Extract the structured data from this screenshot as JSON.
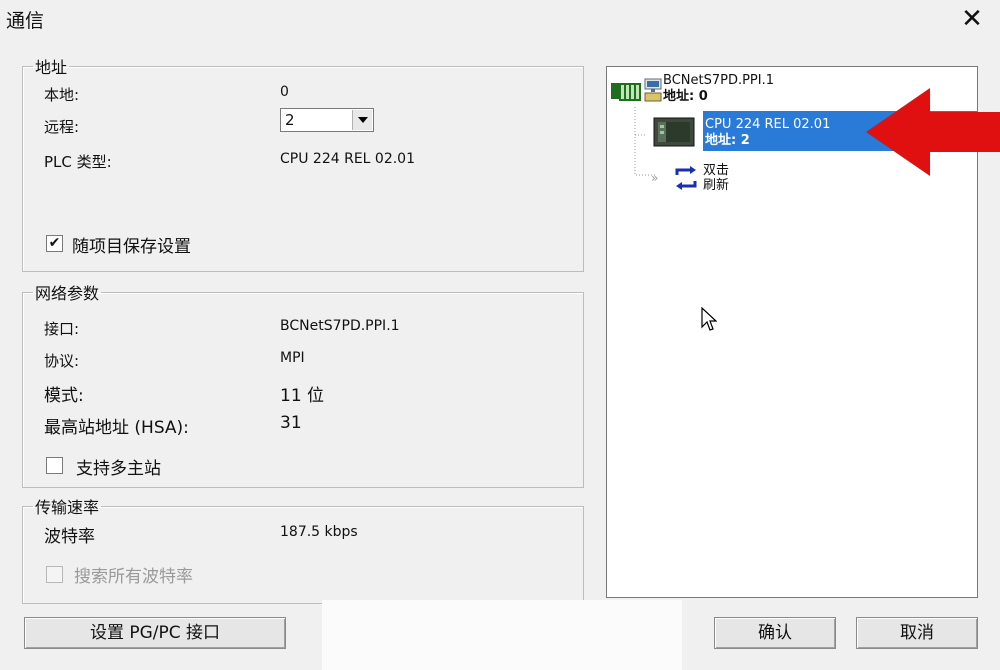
{
  "window": {
    "title": "通信",
    "close_glyph": "✕"
  },
  "address": {
    "legend": "地址",
    "local_label": "本地:",
    "local_value": "0",
    "remote_label": "远程:",
    "remote_value": "2",
    "plc_type_label": "PLC 类型:",
    "plc_type_value": "CPU 224 REL 02.01",
    "save_with_project_label": "随项目保存设置",
    "save_with_project_checked": "✔"
  },
  "network": {
    "legend": "网络参数",
    "interface_label": "接口:",
    "interface_value": "BCNetS7PD.PPI.1",
    "protocol_label": "协议:",
    "protocol_value": "MPI",
    "mode_label": "模式:",
    "mode_value": "11 位",
    "hsa_label": "最高站地址 (HSA):",
    "hsa_value": "31",
    "multi_master_label": "支持多主站"
  },
  "transfer": {
    "legend": "传输速率",
    "baud_label": "波特率",
    "baud_value": "187.5 kbps",
    "search_all_label": "搜索所有波特率"
  },
  "tree": {
    "root_name": "BCNetS7PD.PPI.1",
    "root_address": "地址: 0",
    "cpu_name": "CPU 224 REL 02.01",
    "cpu_address": "地址: 2",
    "refresh_line1": "双击",
    "refresh_line2": "刷新"
  },
  "buttons": {
    "set_pgpc": "设置 PG/PC 接口",
    "ok": "确认",
    "cancel": "取消"
  },
  "colors": {
    "selection": "#2a7bd8",
    "arrow": "#e01010"
  }
}
